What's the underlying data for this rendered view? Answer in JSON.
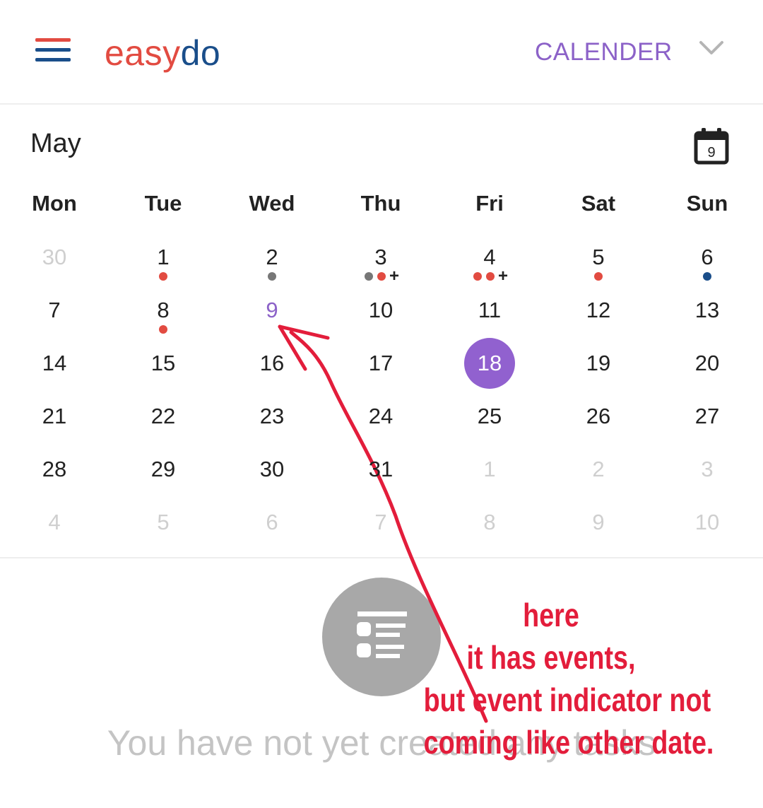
{
  "header": {
    "logo_part1": "easy",
    "logo_part2": "do",
    "view_label": "CALENDER",
    "menu_icon_colors": [
      "#e24b41",
      "#1a4e8a",
      "#1a4e8a"
    ]
  },
  "calendar": {
    "month": "May",
    "today_button_day": "9",
    "weekdays": [
      "Mon",
      "Tue",
      "Wed",
      "Thu",
      "Fri",
      "Sat",
      "Sun"
    ],
    "colors": {
      "accent": "#8c62c8",
      "today_bg": "#9161cf",
      "red": "#e24b41",
      "gray": "#777777",
      "blue": "#1a4e8a"
    },
    "weeks": [
      [
        {
          "day": "30",
          "muted": true,
          "dots": []
        },
        {
          "day": "1",
          "dots": [
            "red"
          ]
        },
        {
          "day": "2",
          "dots": [
            "gray"
          ]
        },
        {
          "day": "3",
          "dots": [
            "gray",
            "red"
          ],
          "plus": "+"
        },
        {
          "day": "4",
          "dots": [
            "red",
            "red"
          ],
          "plus": "+"
        },
        {
          "day": "5",
          "dots": [
            "red"
          ]
        },
        {
          "day": "6",
          "dots": [
            "blue"
          ]
        }
      ],
      [
        {
          "day": "7",
          "dots": []
        },
        {
          "day": "8",
          "dots": [
            "red"
          ]
        },
        {
          "day": "9",
          "selected": true,
          "dots": []
        },
        {
          "day": "10",
          "dots": []
        },
        {
          "day": "11",
          "dots": []
        },
        {
          "day": "12",
          "dots": []
        },
        {
          "day": "13",
          "dots": []
        }
      ],
      [
        {
          "day": "14",
          "dots": []
        },
        {
          "day": "15",
          "dots": []
        },
        {
          "day": "16",
          "dots": []
        },
        {
          "day": "17",
          "dots": []
        },
        {
          "day": "18",
          "today": true,
          "dots": []
        },
        {
          "day": "19",
          "dots": []
        },
        {
          "day": "20",
          "dots": []
        }
      ],
      [
        {
          "day": "21",
          "dots": []
        },
        {
          "day": "22",
          "dots": []
        },
        {
          "day": "23",
          "dots": []
        },
        {
          "day": "24",
          "dots": []
        },
        {
          "day": "25",
          "dots": []
        },
        {
          "day": "26",
          "dots": []
        },
        {
          "day": "27",
          "dots": []
        }
      ],
      [
        {
          "day": "28",
          "dots": []
        },
        {
          "day": "29",
          "dots": []
        },
        {
          "day": "30",
          "dots": []
        },
        {
          "day": "31",
          "dots": []
        },
        {
          "day": "1",
          "muted": true,
          "dots": []
        },
        {
          "day": "2",
          "muted": true,
          "dots": []
        },
        {
          "day": "3",
          "muted": true,
          "dots": []
        }
      ],
      [
        {
          "day": "4",
          "muted": true,
          "dots": []
        },
        {
          "day": "5",
          "muted": true,
          "dots": []
        },
        {
          "day": "6",
          "muted": true,
          "dots": []
        },
        {
          "day": "7",
          "muted": true,
          "dots": []
        },
        {
          "day": "8",
          "muted": true,
          "dots": []
        },
        {
          "day": "9",
          "muted": true,
          "dots": []
        },
        {
          "day": "10",
          "muted": true,
          "dots": []
        }
      ]
    ]
  },
  "empty_state": {
    "icon": "task-list-icon",
    "message": "You have not yet created any tasks"
  },
  "annotation": {
    "color": "#e31d3b",
    "lines": [
      "here",
      "it has events,",
      "but event indicator not",
      "coming like other date."
    ]
  }
}
